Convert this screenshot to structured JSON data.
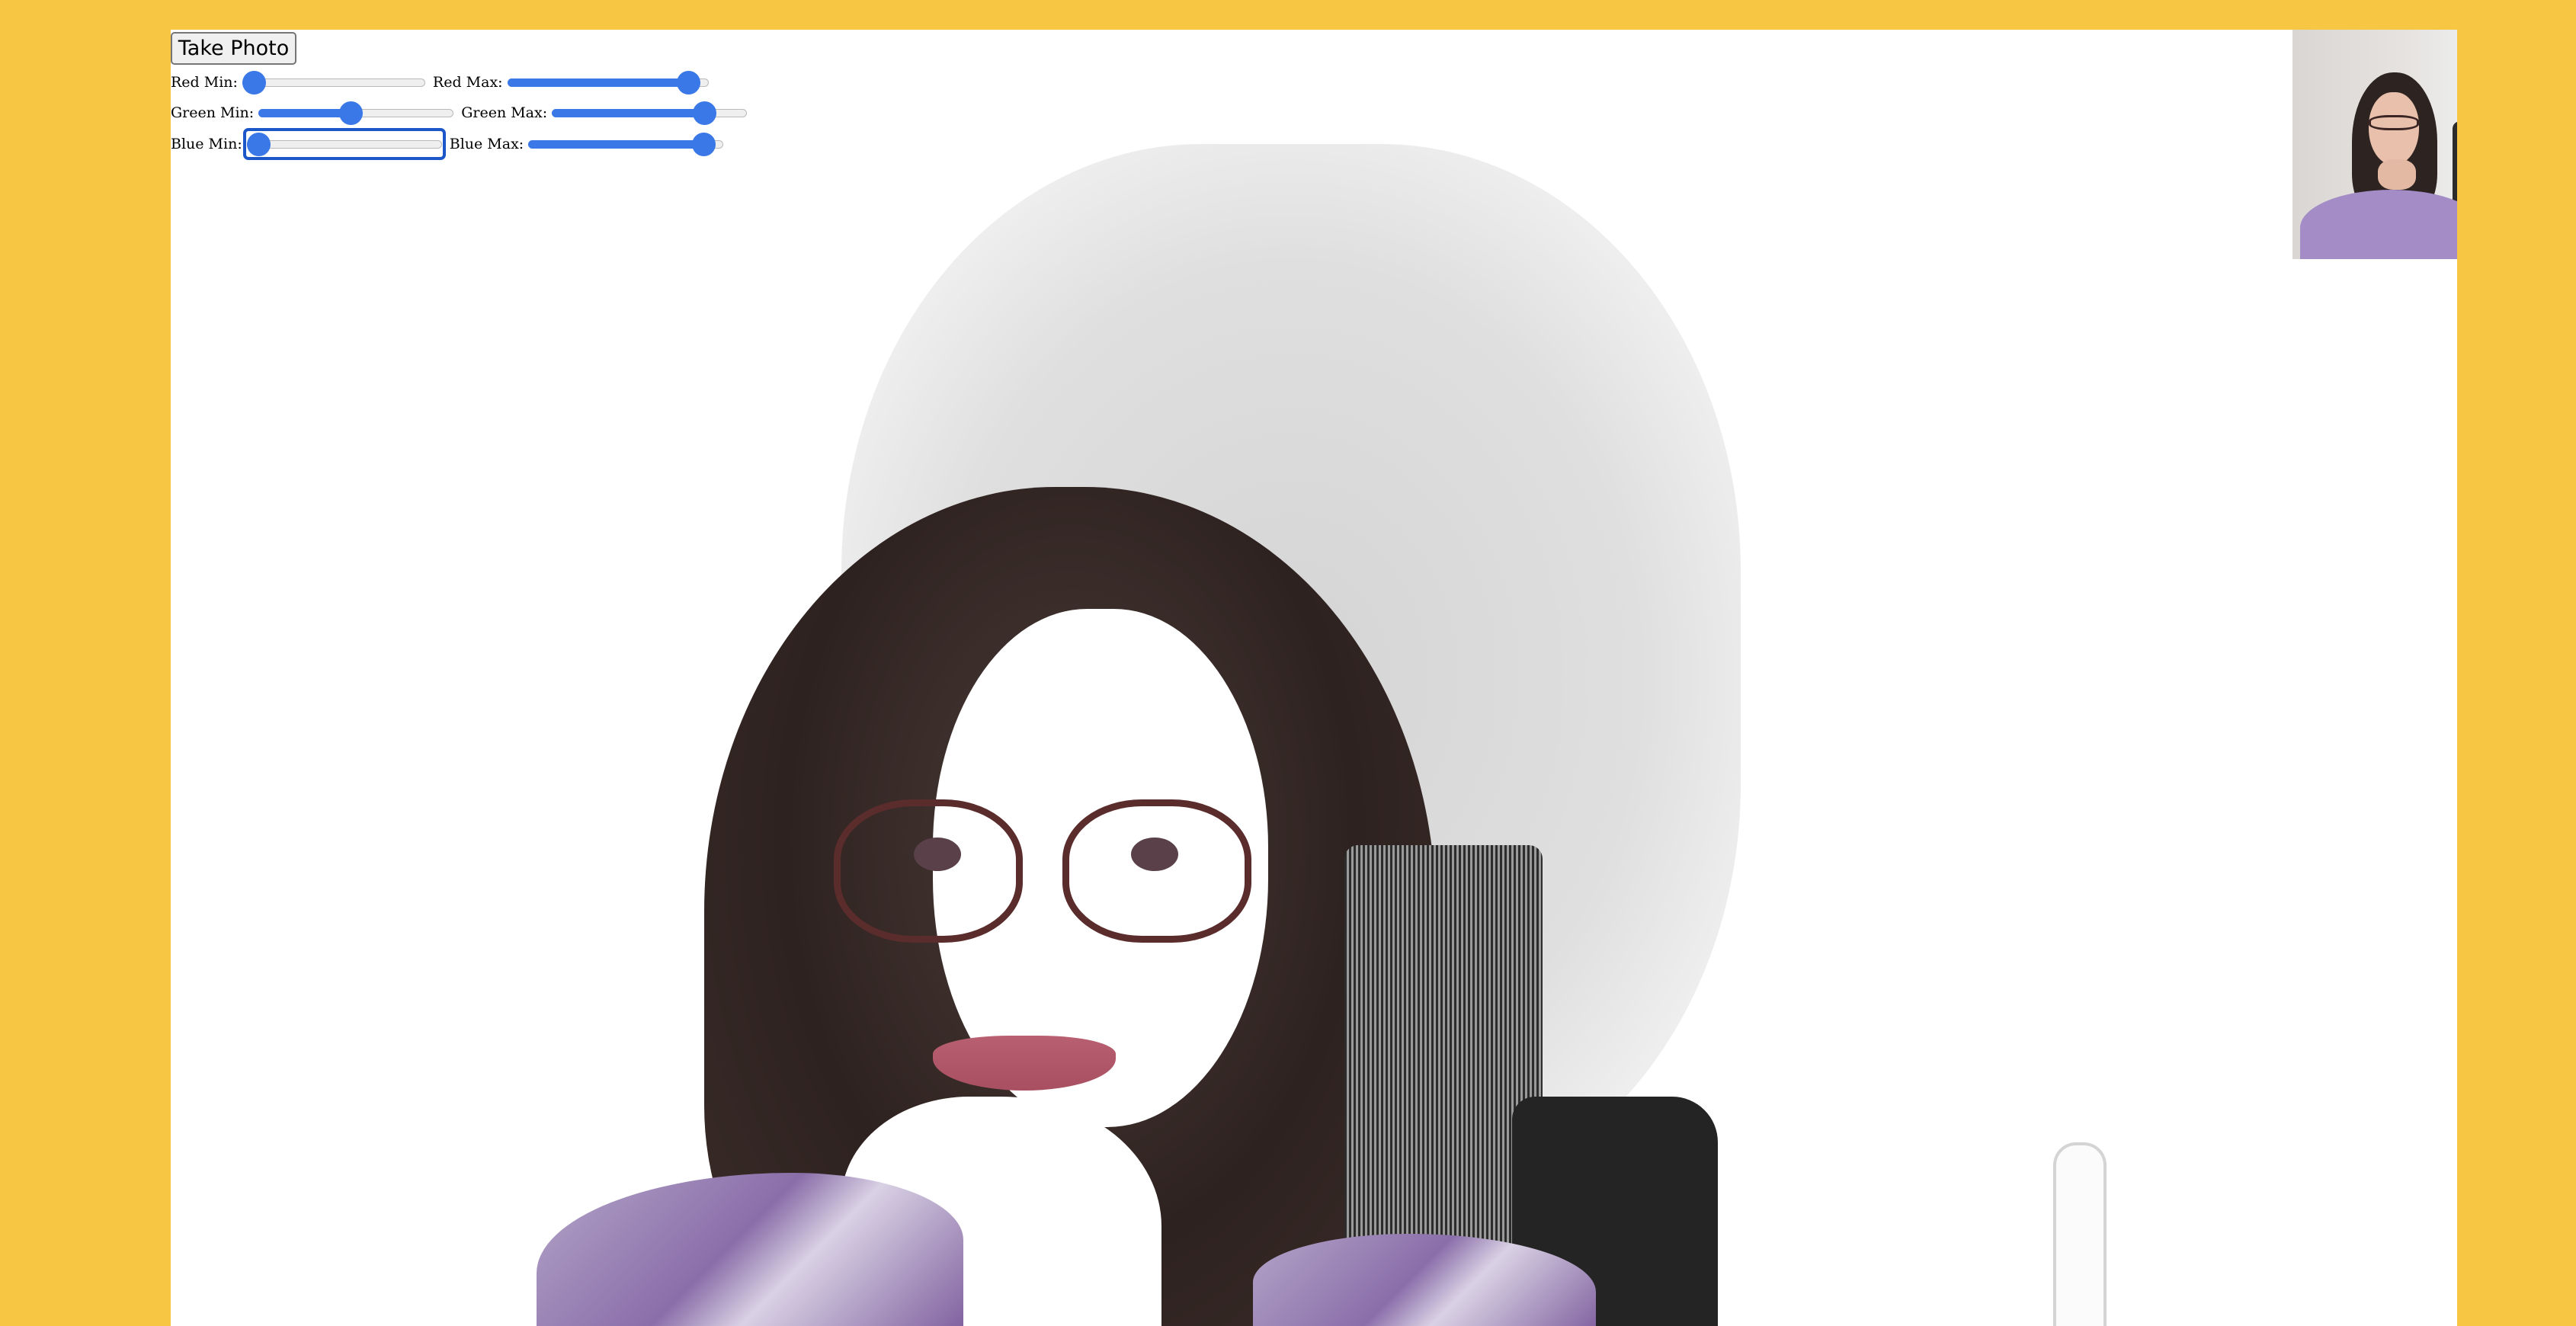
{
  "controls": {
    "take_photo_label": "Take Photo",
    "red_min_label": "Red Min:",
    "red_max_label": "Red Max:",
    "green_min_label": "Green Min:",
    "green_max_label": "Green Max:",
    "blue_min_label": "Blue Min:",
    "blue_max_label": "Blue Max:",
    "red_min_value": 0.0,
    "red_max_value": 0.95,
    "green_min_value": 0.47,
    "green_max_value": 0.82,
    "blue_min_value": 0.0,
    "blue_max_value": 0.95,
    "focused_slider": "Blue Min:"
  },
  "colors": {
    "page_background": "#f7c744",
    "canvas_background": "#ffffff",
    "slider_accent": "#3a78e8"
  },
  "images": {
    "processed_photo": "webcam-frame-color-threshold-filtered",
    "live_preview": "webcam-live-preview"
  }
}
